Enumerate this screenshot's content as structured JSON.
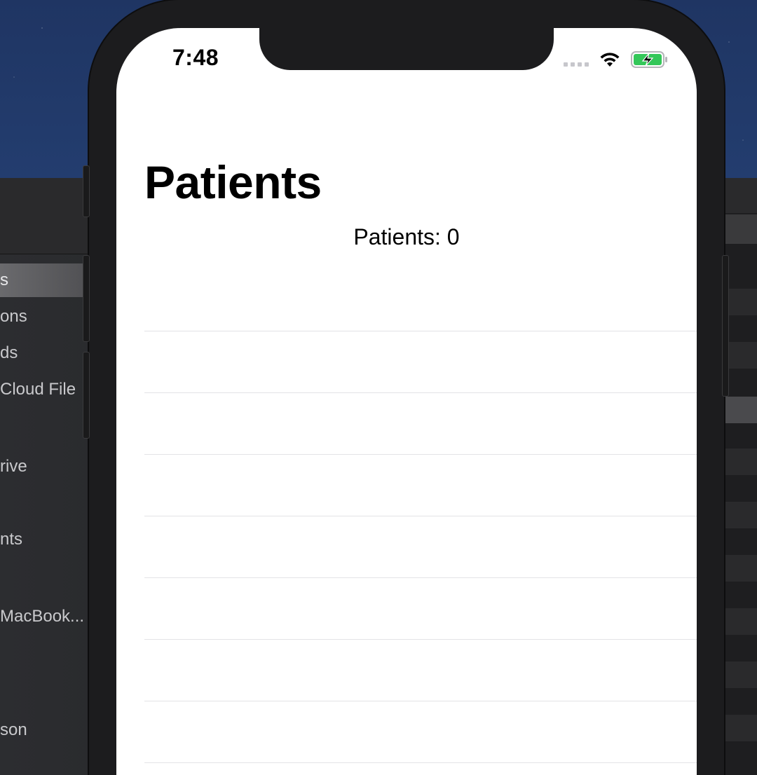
{
  "status_bar": {
    "time": "7:48",
    "signal_icon": "cellular-signal-icon",
    "wifi_icon": "wifi-icon",
    "battery_icon": "battery-charging-icon",
    "battery_color": "#34c759"
  },
  "nav": {
    "large_title": "Patients"
  },
  "summary": {
    "count_label": "Patients: 0"
  },
  "background_sidebar": {
    "items": [
      {
        "label": "s",
        "selected": true
      },
      {
        "label": "ons"
      },
      {
        "label": "ds"
      },
      {
        "label": "Cloud File"
      },
      {
        "label": "rive"
      },
      {
        "label": "nts"
      },
      {
        "label": "MacBook..."
      },
      {
        "label": "son"
      }
    ]
  },
  "colors": {
    "desktop": "#2a4a82",
    "screen_bg": "#ffffff",
    "separator": "#e3e3e6",
    "phone_frame": "#1c1c1e"
  }
}
